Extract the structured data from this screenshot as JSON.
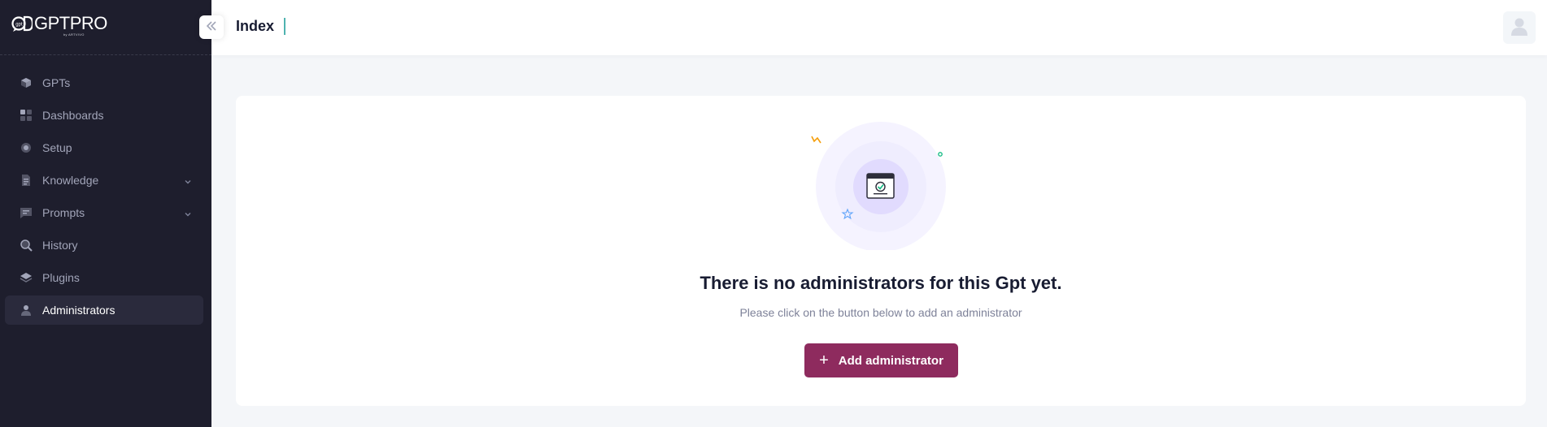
{
  "brand": {
    "name": "GPTPRO",
    "sub": "by ARTVIVO"
  },
  "sidebar": {
    "items": [
      {
        "label": "GPTs",
        "icon": "gpts-icon",
        "has_chevron": false,
        "active": false
      },
      {
        "label": "Dashboards",
        "icon": "dashboard-icon",
        "has_chevron": false,
        "active": false
      },
      {
        "label": "Setup",
        "icon": "gear-icon",
        "has_chevron": false,
        "active": false
      },
      {
        "label": "Knowledge",
        "icon": "document-icon",
        "has_chevron": true,
        "active": false
      },
      {
        "label": "Prompts",
        "icon": "chat-icon",
        "has_chevron": true,
        "active": false
      },
      {
        "label": "History",
        "icon": "search-icon",
        "has_chevron": false,
        "active": false
      },
      {
        "label": "Plugins",
        "icon": "layers-icon",
        "has_chevron": false,
        "active": false
      },
      {
        "label": "Administrators",
        "icon": "user-icon",
        "has_chevron": false,
        "active": true
      }
    ]
  },
  "header": {
    "title": "Index"
  },
  "empty_state": {
    "title": "There is no administrators for this Gpt yet.",
    "subtitle": "Please click on the button below to add an administrator",
    "button_label": "Add administrator"
  },
  "colors": {
    "sidebar_bg": "#1e1e2d",
    "active_item_bg": "#2a2a3c",
    "accent_button": "#8e2b5e",
    "title_separator": "#4fb3b0",
    "page_bg": "#f4f6f9"
  }
}
